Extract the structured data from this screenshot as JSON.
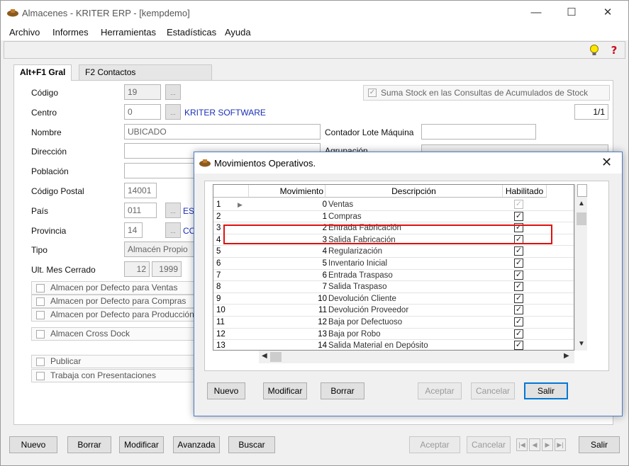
{
  "window": {
    "title": "Almacenes - KRITER ERP - [kempdemo]",
    "controls": {
      "minimize": "—",
      "maximize": "☐",
      "close": "✕"
    }
  },
  "menu": [
    "Archivo",
    "Informes",
    "Herramientas",
    "Estadísticas",
    "Ayuda"
  ],
  "tabs": {
    "general": "Alt+F1 Gral",
    "contactos": "F2 Contactos"
  },
  "form": {
    "codigo": {
      "label": "Código",
      "value": "19",
      "btn": "..."
    },
    "centro": {
      "label": "Centro",
      "value": "0",
      "btn": "...",
      "name": "KRITER SOFTWARE"
    },
    "nombre": {
      "label": "Nombre",
      "value": "UBICADO"
    },
    "direccion": {
      "label": "Dirección"
    },
    "poblacion": {
      "label": "Población"
    },
    "codigo_postal": {
      "label": "Código Postal",
      "value": "14001"
    },
    "pais": {
      "label": "País",
      "value": "011",
      "btn": "...",
      "name": "ES"
    },
    "provincia": {
      "label": "Provincia",
      "value": "14",
      "btn": "...",
      "name": "CO"
    },
    "tipo": {
      "label": "Tipo",
      "value": "Almacén Propio"
    },
    "ult_mes": {
      "label": "Ult. Mes Cerrado",
      "month": "12",
      "year": "1999"
    },
    "suma_stock": "Suma Stock en las Consultas de Acumulados de Stock",
    "pager": "1/1",
    "contador_lote": {
      "label": "Contador Lote Máquina"
    },
    "agrupacion": {
      "label": "Agrupación"
    },
    "checks": {
      "ventas": "Almacen por Defecto para Ventas",
      "compras": "Almacen por Defecto para Compras",
      "produccion": "Almacen por Defecto para Producción",
      "cross_dock": "Almacen Cross Dock",
      "publicar": "Publicar",
      "presentaciones": "Trabaja con Presentaciones"
    }
  },
  "bottom_buttons": {
    "nuevo": "Nuevo",
    "borrar": "Borrar",
    "modificar": "Modificar",
    "avanzada": "Avanzada",
    "buscar": "Buscar",
    "aceptar": "Aceptar",
    "cancelar": "Cancelar",
    "salir": "Salir"
  },
  "icons": {
    "help": "lightbulb-icon",
    "alert": "help-question-icon"
  },
  "dialog": {
    "title": "Movimientos Operativos.",
    "close": "✕",
    "columns": {
      "movimiento": "Movimiento",
      "descripcion": "Descripción",
      "habilitado": "Habilitado"
    },
    "rows": [
      {
        "n": "1",
        "mov": "0",
        "desc": "Ventas",
        "checked": true,
        "disabled": true
      },
      {
        "n": "2",
        "mov": "1",
        "desc": "Compras",
        "checked": true
      },
      {
        "n": "3",
        "mov": "2",
        "desc": "Entrada Fabricación",
        "checked": true
      },
      {
        "n": "4",
        "mov": "3",
        "desc": "Salida Fabricación",
        "checked": true
      },
      {
        "n": "5",
        "mov": "4",
        "desc": "Regularización",
        "checked": true
      },
      {
        "n": "6",
        "mov": "5",
        "desc": "Inventario Inicial",
        "checked": true
      },
      {
        "n": "7",
        "mov": "6",
        "desc": "Entrada Traspaso",
        "checked": true
      },
      {
        "n": "8",
        "mov": "7",
        "desc": "Salida Traspaso",
        "checked": true
      },
      {
        "n": "9",
        "mov": "10",
        "desc": "Devolución Cliente",
        "checked": true
      },
      {
        "n": "10",
        "mov": "11",
        "desc": "Devolución Proveedor",
        "checked": true
      },
      {
        "n": "11",
        "mov": "12",
        "desc": "Baja por Defectuoso",
        "checked": true
      },
      {
        "n": "12",
        "mov": "13",
        "desc": "Baja por Robo",
        "checked": true
      },
      {
        "n": "13",
        "mov": "14",
        "desc": "Salida Material en Depósito",
        "checked": true
      }
    ],
    "buttons": {
      "nuevo": "Nuevo",
      "modificar": "Modificar",
      "borrar": "Borrar",
      "aceptar": "Aceptar",
      "cancelar": "Cancelar",
      "salir": "Salir"
    },
    "highlight_color": "#e01010"
  }
}
